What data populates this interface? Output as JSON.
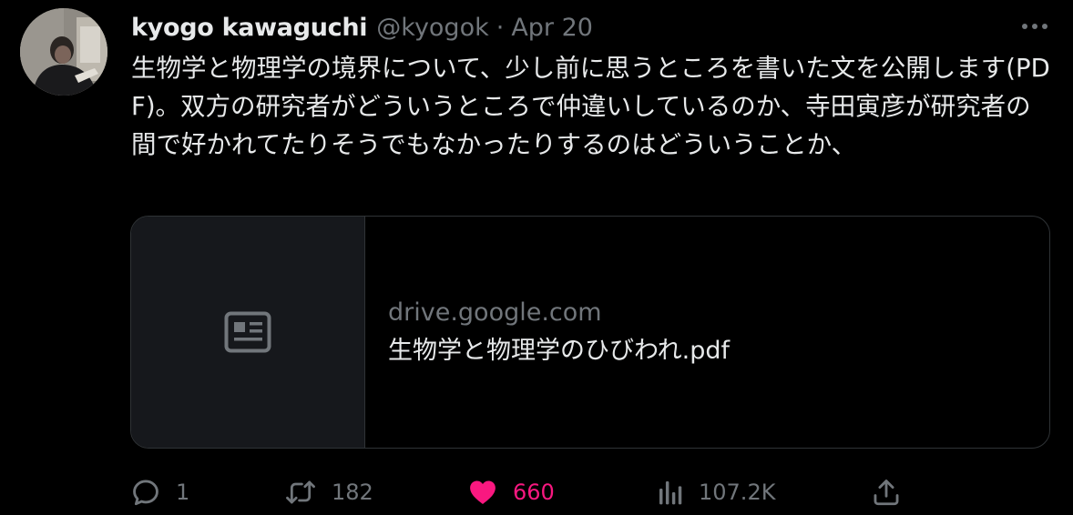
{
  "tweet": {
    "display_name": "kyogo kawaguchi",
    "handle": "@kyogok",
    "separator": "·",
    "date": "Apr 20",
    "text": "生物学と物理学の境界について、少し前に思うところを書いた文を公開します(PDF)。双方の研究者がどういうところで仲違いしているのか、寺田寅彦が研究者の間で好かれてたりそうでもなかったりするのはどういうことか、"
  },
  "card": {
    "domain": "drive.google.com",
    "title": "生物学と物理学のひびわれ.pdf",
    "icon": "article-icon"
  },
  "actions": {
    "reply_count": "1",
    "retweet_count": "182",
    "like_count": "660",
    "views_count": "107.2K"
  },
  "icons": {
    "more": "more-icon",
    "reply": "reply-icon",
    "retweet": "retweet-icon",
    "like": "heart-icon",
    "views": "views-icon",
    "share": "share-icon"
  },
  "colors": {
    "background": "#000000",
    "text": "#e7e9ea",
    "secondary": "#71767b",
    "border": "#2f3336",
    "like": "#f91880"
  }
}
